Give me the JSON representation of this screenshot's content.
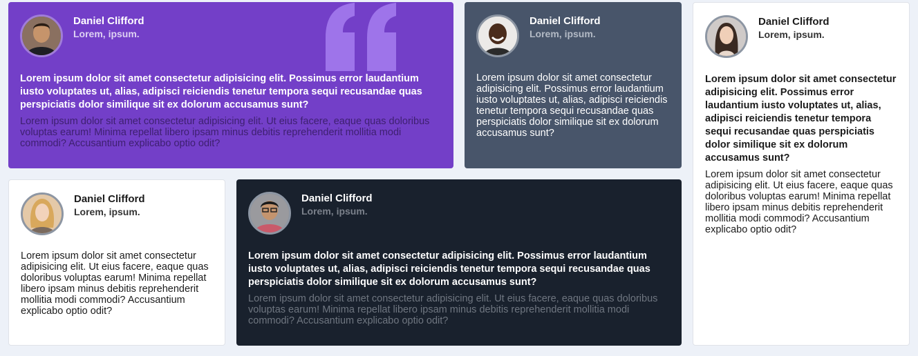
{
  "colors": {
    "purple": "#733fc8",
    "slate": "#48556a",
    "white": "#ffffff",
    "dark": "#19212d",
    "background": "#edf1f8",
    "quote": "#a67ef0"
  },
  "testimonials": [
    {
      "name": "Daniel Clifford",
      "role": "Lorem, ipsum.",
      "lead": "Lorem ipsum dolor sit amet consectetur adipisicing elit. Possimus error laudantium iusto voluptates ut, alias, adipisci reiciendis tenetur tempora sequi recusandae quas perspiciatis dolor similique sit ex dolorum accusamus sunt?",
      "body": "Lorem ipsum dolor sit amet consectetur adipisicing elit. Ut eius facere, eaque quas doloribus voluptas earum! Minima repellat libero ipsam minus debitis reprehenderit mollitia modi commodi? Accusantium explicabo optio odit?"
    },
    {
      "name": "Daniel Clifford",
      "role": "Lorem, ipsum.",
      "body": "Lorem ipsum dolor sit amet consectetur adipisicing elit. Possimus error laudantium iusto voluptates ut, alias, adipisci reiciendis tenetur tempora sequi recusandae quas perspiciatis dolor similique sit ex dolorum accusamus sunt?"
    },
    {
      "name": "Daniel Clifford",
      "role": "Lorem, ipsum.",
      "lead": "Lorem ipsum dolor sit amet consectetur adipisicing elit. Possimus error laudantium iusto voluptates ut, alias, adipisci reiciendis tenetur tempora sequi recusandae quas perspiciatis dolor similique sit ex dolorum accusamus sunt?",
      "body": "Lorem ipsum dolor sit amet consectetur adipisicing elit. Ut eius facere, eaque quas doloribus voluptas earum! Minima repellat libero ipsam minus debitis reprehenderit mollitia modi commodi? Accusantium explicabo optio odit?"
    },
    {
      "name": "Daniel Clifford",
      "role": "Lorem, ipsum.",
      "body": "Lorem ipsum dolor sit amet consectetur adipisicing elit. Ut eius facere, eaque quas doloribus voluptas earum! Minima repellat libero ipsam minus debitis reprehenderit mollitia modi commodi? Accusantium explicabo optio odit?"
    },
    {
      "name": "Daniel Clifford",
      "role": "Lorem, ipsum.",
      "lead": "Lorem ipsum dolor sit amet consectetur adipisicing elit. Possimus error laudantium iusto voluptates ut, alias, adipisci reiciendis tenetur tempora sequi recusandae quas perspiciatis dolor similique sit ex dolorum accusamus sunt?",
      "body": "Lorem ipsum dolor sit amet consectetur adipisicing elit. Ut eius facere, eaque quas doloribus voluptas earum! Minima repellat libero ipsam minus debitis reprehenderit mollitia modi commodi? Accusantium explicabo optio odit?"
    }
  ],
  "icons": {
    "quote": "quote-icon",
    "avatar": "avatar-icon"
  }
}
